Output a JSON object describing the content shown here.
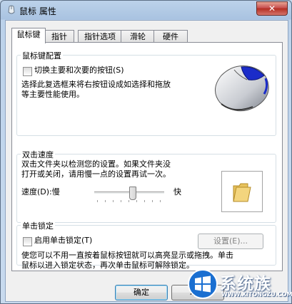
{
  "window": {
    "title": "鼠标 属性",
    "close_glyph": "✕"
  },
  "tabs": [
    {
      "label": "鼠标键",
      "active": true
    },
    {
      "label": "指针",
      "active": false
    },
    {
      "label": "指针选项",
      "active": false
    },
    {
      "label": "滑轮",
      "active": false
    },
    {
      "label": "硬件",
      "active": false
    }
  ],
  "buttons_config": {
    "title": "鼠标键配置",
    "switch_checkbox_label": "切换主要和次要的按钮(S)",
    "switch_checked": false,
    "description_line1": "选择此复选框来将右按钮设成如选择和拖放",
    "description_line2": "等主要性能使用。"
  },
  "double_click": {
    "title": "双击速度",
    "description_line1": "双击文件夹以检测您的设置。如果文件夹没",
    "description_line2": "打开或关闭，请用慢一点的设置再试一次。",
    "speed_label": "速度(D):慢",
    "fast_label": "快",
    "speed_level_fraction": 0.55
  },
  "click_lock": {
    "title": "单击锁定",
    "checkbox_label": "启用单击锁定(T)",
    "checked": false,
    "settings_button": "设置(E)...",
    "description_line1": "使您可以不用一直按着鼠标按钮就可以高亮显示或拖拽。单击",
    "description_line2": "鼠标以进入锁定状态，再次单击鼠标可解除锁定。"
  },
  "footer": {
    "ok_button": "确定",
    "cancel_button": "取消"
  },
  "watermark": {
    "brand": "系统族",
    "url": "WWW.XITONGZU.COM"
  }
}
